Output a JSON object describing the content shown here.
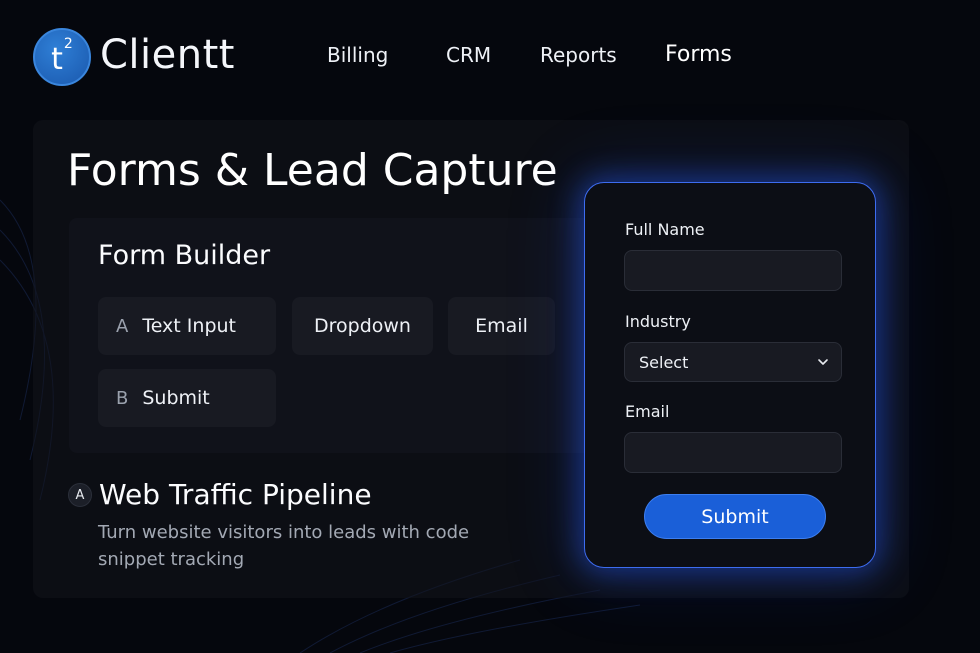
{
  "header": {
    "logo_mark": "t",
    "logo_superscript": "2",
    "brand": "Clientt",
    "nav": [
      {
        "label": "Billing"
      },
      {
        "label": "CRM"
      },
      {
        "label": "Reports"
      },
      {
        "label": "Forms"
      }
    ]
  },
  "main": {
    "title": "Forms & Lead Capture",
    "builder": {
      "title": "Form Builder",
      "chips": [
        {
          "key": "A",
          "label": "Text Input"
        },
        {
          "key": "",
          "label": "Dropdown"
        },
        {
          "key": "",
          "label": "Email"
        },
        {
          "key": "B",
          "label": "Submit"
        }
      ]
    },
    "pipeline": {
      "key": "A",
      "title": "Web Traffic Pipeline",
      "description": "Turn website visitors into leads with code snippet tracking"
    }
  },
  "form": {
    "full_name_label": "Full Name",
    "full_name_value": "",
    "industry_label": "Industry",
    "industry_selected": "Select",
    "email_label": "Email",
    "email_value": "",
    "submit_label": "Submit"
  },
  "colors": {
    "background": "#05070d",
    "accent": "#1a5fd8",
    "glow": "#3d6cf0",
    "logo": "#1f62b8"
  },
  "icons": {
    "dropdown": "chevron-down-icon"
  }
}
